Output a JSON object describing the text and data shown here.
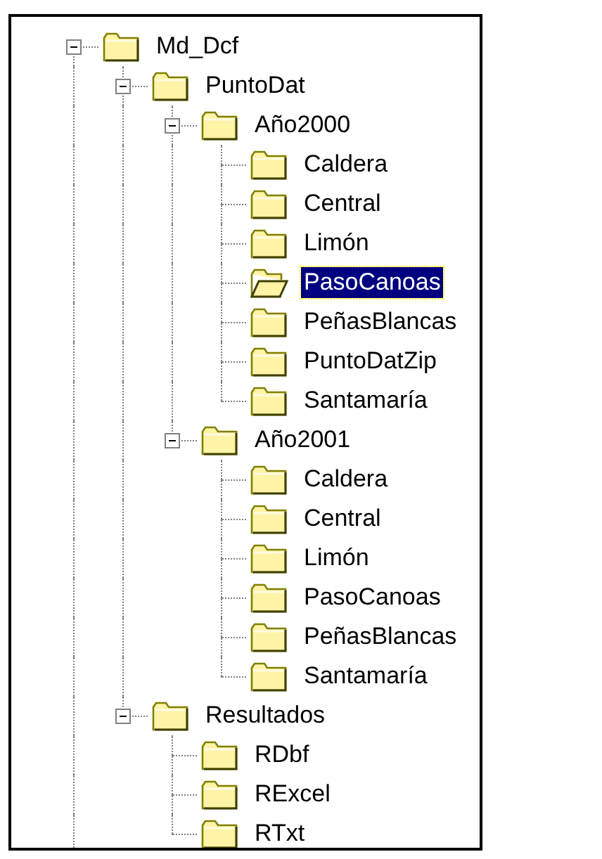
{
  "tree": [
    {
      "label": "Md_Dcf",
      "expanded": true,
      "selected": false,
      "children": [
        {
          "label": "PuntoDat",
          "expanded": true,
          "selected": false,
          "children": [
            {
              "label": "Año2000",
              "expanded": true,
              "selected": false,
              "children": [
                {
                  "label": "Caldera",
                  "selected": false
                },
                {
                  "label": "Central",
                  "selected": false
                },
                {
                  "label": "Limón",
                  "selected": false
                },
                {
                  "label": "PasoCanoas",
                  "selected": true
                },
                {
                  "label": "PeñasBlancas",
                  "selected": false
                },
                {
                  "label": "PuntoDatZip",
                  "selected": false
                },
                {
                  "label": "Santamaría",
                  "selected": false
                }
              ]
            },
            {
              "label": "Año2001",
              "expanded": true,
              "selected": false,
              "children": [
                {
                  "label": "Caldera",
                  "selected": false
                },
                {
                  "label": "Central",
                  "selected": false
                },
                {
                  "label": "Limón",
                  "selected": false
                },
                {
                  "label": "PasoCanoas",
                  "selected": false
                },
                {
                  "label": "PeñasBlancas",
                  "selected": false
                },
                {
                  "label": "Santamaría",
                  "selected": false
                }
              ]
            }
          ]
        },
        {
          "label": "Resultados",
          "expanded": true,
          "selected": false,
          "children": [
            {
              "label": "RDbf",
              "selected": false
            },
            {
              "label": "RExcel",
              "selected": false
            },
            {
              "label": "RTxt",
              "selected": false
            }
          ]
        }
      ]
    }
  ]
}
